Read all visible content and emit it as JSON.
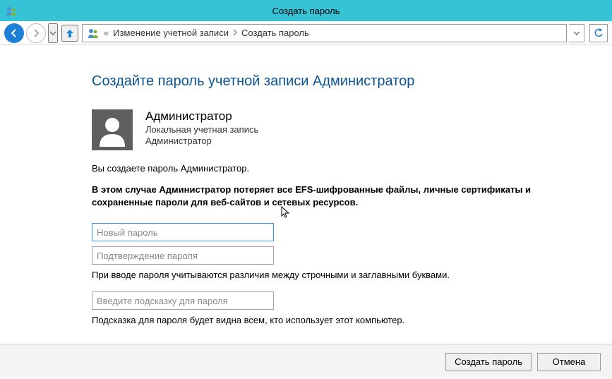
{
  "window": {
    "title": "Создать пароль"
  },
  "breadcrumb": {
    "item1": "Изменение учетной записи",
    "item2": "Создать пароль"
  },
  "page": {
    "title": "Создайте пароль учетной записи Администратор"
  },
  "user": {
    "name": "Администратор",
    "account_type": "Локальная учетная запись",
    "role": "Администратор"
  },
  "messages": {
    "creating": "Вы создаете пароль Администратор.",
    "warning": "В этом случае Администратор потеряет все EFS-шифрованные файлы, личные сертификаты и сохраненные пароли для веб-сайтов и сетевых ресурсов.",
    "case_note": "При вводе пароля учитываются различия между строчными и заглавными буквами.",
    "hint_note": "Подсказка для пароля будет видна всем, кто использует этот компьютер."
  },
  "inputs": {
    "new_password_placeholder": "Новый пароль",
    "confirm_password_placeholder": "Подтверждение пароля",
    "hint_placeholder": "Введите подсказку для пароля"
  },
  "buttons": {
    "create": "Создать пароль",
    "cancel": "Отмена"
  }
}
